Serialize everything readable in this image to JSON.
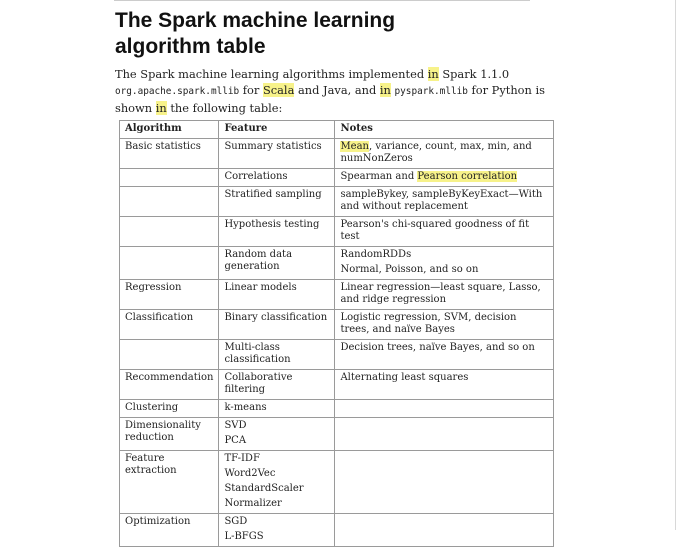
{
  "heading": "The Spark machine learning algorithm table",
  "intro": {
    "t1": "The Spark machine learning algorithms implemented ",
    "h1": "in",
    "t2": " Spark 1.1.0 ",
    "code1": "org.apache.spark.mllib",
    "t3": " for ",
    "h2": "Scala",
    "t4": " and Java, and ",
    "h3": "in",
    "t5": " ",
    "code2": "pyspark.mllib",
    "t6": " for Python is shown ",
    "h4": "in",
    "t7": " the following table:"
  },
  "table": {
    "headers": {
      "algorithm": "Algorithm",
      "feature": "Feature",
      "notes": "Notes"
    },
    "r1": {
      "algorithm": "Basic statistics",
      "feature": "Summary statistics",
      "notes_hl": "Mean",
      "notes_rest": ", variance, count, max, min, and numNonZeros"
    },
    "r2": {
      "feature": "Correlations",
      "notes_pre": "Spearman and ",
      "notes_hl": "Pearson correlation"
    },
    "r3": {
      "feature": "Stratified sampling",
      "notes": "sampleBykey, sampleByKeyExact—With and without replacement"
    },
    "r4": {
      "feature": "Hypothesis testing",
      "notes": "Pearson's chi-squared goodness of fit test"
    },
    "r5": {
      "feature": "Random data generation",
      "notes1": "RandomRDDs",
      "notes2": "Normal, Poisson, and so on"
    },
    "r6": {
      "algorithm": "Regression",
      "feature": "Linear models",
      "notes": "Linear regression—least square, Lasso, and ridge regression"
    },
    "r7": {
      "algorithm": "Classification",
      "feature": "Binary classification",
      "notes": "Logistic regression, SVM, decision trees, and naïve Bayes"
    },
    "r8": {
      "feature": "Multi-class classification",
      "notes": "Decision trees, naïve Bayes, and so on"
    },
    "r9": {
      "algorithm": "Recommendation",
      "feature": "Collaborative filtering",
      "notes": "Alternating least squares"
    },
    "r10": {
      "algorithm": "Clustering",
      "feature": "k-means"
    },
    "r11": {
      "algorithm": "Dimensionality reduction",
      "f1": "SVD",
      "f2": "PCA"
    },
    "r12": {
      "algorithm": "Feature extraction",
      "f1": "TF-IDF",
      "f2": "Word2Vec",
      "f3": "StandardScaler",
      "f4": "Normalizer"
    },
    "r13": {
      "algorithm": "Optimization",
      "f1": "SGD",
      "f2": "L-BFGS"
    }
  }
}
